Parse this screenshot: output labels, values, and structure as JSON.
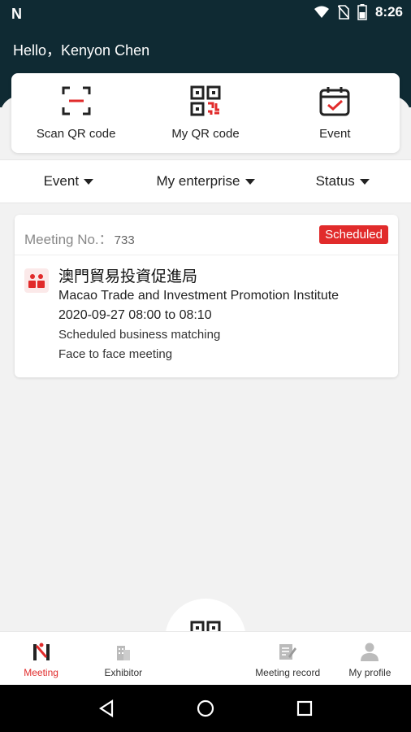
{
  "status_bar": {
    "carrier_logo": "N",
    "time": "8:26",
    "icons": [
      "wifi-icon",
      "no-sim-icon",
      "battery-icon"
    ]
  },
  "header": {
    "greeting": "Hello，Kenyon Chen"
  },
  "quick_actions": [
    {
      "label": "Scan QR code",
      "icon": "scan-icon"
    },
    {
      "label": "My QR code",
      "icon": "qr-code-icon"
    },
    {
      "label": "Event",
      "icon": "calendar-check-icon"
    }
  ],
  "filters": [
    {
      "label": "Event"
    },
    {
      "label": "My enterprise"
    },
    {
      "label": "Status"
    }
  ],
  "meeting": {
    "label": "Meeting No.：",
    "number": "733",
    "status": "Scheduled",
    "org_name_zh": "澳門貿易投資促進局",
    "org_name_en": "Macao Trade and Investment Promotion Institute",
    "time": "2020-09-27 08:00 to 08:10",
    "type": "Scheduled business matching",
    "mode": "Face to face meeting"
  },
  "tabs": [
    {
      "label": "Meeting",
      "icon": "meeting-icon",
      "active": true
    },
    {
      "label": "Exhibitor",
      "icon": "building-icon",
      "active": false
    },
    {
      "label": "",
      "icon": "qr-code-icon",
      "active": false
    },
    {
      "label": "Meeting record",
      "icon": "edit-note-icon",
      "active": false
    },
    {
      "label": "My profile",
      "icon": "person-icon",
      "active": false
    }
  ],
  "colors": {
    "header_bg": "#0f2a33",
    "accent": "#e12b2b",
    "page_bg": "#f2f2f2"
  }
}
